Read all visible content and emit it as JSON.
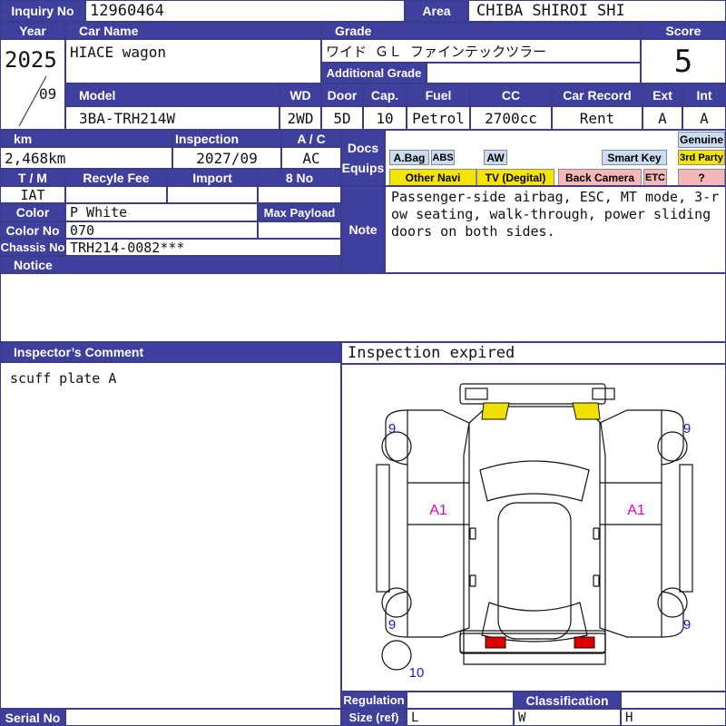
{
  "labels": {
    "inquiry_no": "Inquiry No",
    "area": "Area",
    "year": "Year",
    "car_name": "Car Name",
    "grade": "Grade",
    "score": "Score",
    "additional_grade": "Additional Grade",
    "model": "Model",
    "wd": "WD",
    "door": "Door",
    "cap": "Cap.",
    "fuel": "Fuel",
    "cc": "CC",
    "car_record": "Car Record",
    "ext": "Ext",
    "int": "Int",
    "km": "km",
    "inspection": "Inspection",
    "ac": "A / C",
    "docs": "Docs",
    "equips": "Equips",
    "tm": "T / M",
    "recycle_fee": "Recyle Fee",
    "import": "Import",
    "eight_no": "8 No",
    "color": "Color",
    "max_payload": "Max Payload",
    "color_no": "Color No",
    "chassis_no": "Chassis No",
    "notice": "Notice",
    "note": "Note",
    "inspectors_comment": "Inspector’s Comment",
    "regulation": "Regulation",
    "classification": "Classification",
    "size_ref": "Size (ref)",
    "serial_no": "Serial No"
  },
  "values": {
    "inquiry_no": "12960464",
    "area": "CHIBA SHIROI SHI",
    "year": "2025",
    "month": "09",
    "car_name": "HIACE wagon",
    "grade": "ワイド ＧＬ ファインテックツラー",
    "score": "5",
    "model": "3BA-TRH214W",
    "wd": "2WD",
    "door": "5D",
    "cap": "10",
    "fuel": "Petrol",
    "cc": "2700cc",
    "car_record": "Rent",
    "ext": "A",
    "int": "A",
    "km": "2,468km",
    "inspection": "2027/09",
    "ac": "AC",
    "tm": "IAT",
    "color": "P White",
    "color_no": "070",
    "chassis_no": "TRH214-0082***",
    "note": "Passenger-side airbag, ESC, MT mode, 3-row seating, walk-through, power sliding doors on both sides.",
    "inspectors_comment": "scuff plate A",
    "inspection_status": "Inspection expired",
    "size_l": "L",
    "size_w": "W",
    "size_h": "H"
  },
  "equips": {
    "abag": "A.Bag",
    "abs": "ABS",
    "aw": "AW",
    "smart_key": "Smart Key",
    "genuine": "Genuine",
    "other_navi": "Other Navi",
    "tv": "TV (Degital)",
    "back_camera": "Back Camera",
    "etc": "ETC",
    "third_party": "3rd Party",
    "unknown": "?"
  },
  "diagram": {
    "marks": {
      "left_side": "A1",
      "right_side": "A1"
    },
    "tire_marks": {
      "fl": "9",
      "fr": "9",
      "rl": "9",
      "rr": "9",
      "spare": "10"
    }
  },
  "colors": {
    "header": "#3f3f9e",
    "yellow_badge": "#f5e400",
    "light_blue_badge": "#c9dcf2",
    "pink_badge": "#f4b8b8",
    "damage_text": "#e000c0",
    "tire_text": "#1a1ad0",
    "lamp_yellow": "#f0e000",
    "lamp_red": "#e00000"
  }
}
